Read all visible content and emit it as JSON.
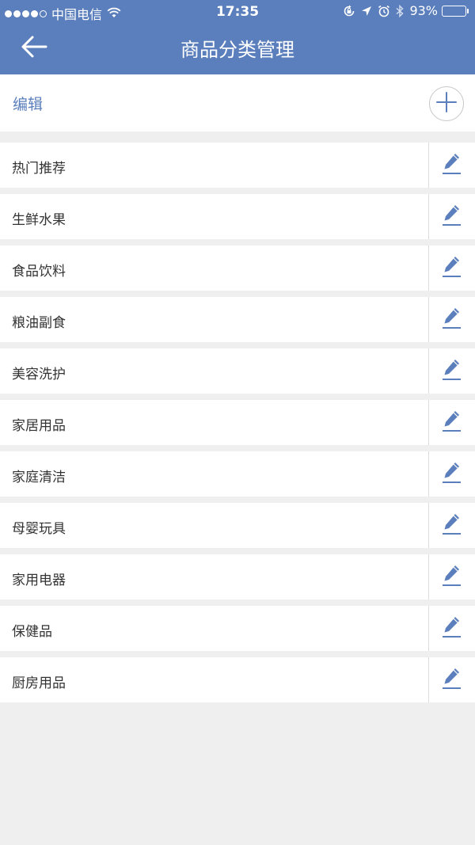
{
  "status_bar": {
    "carrier": "中国电信",
    "time": "17:35",
    "battery": "93%",
    "battery_level": 0.93,
    "signal_dots_filled": 4,
    "signal_dots_total": 5
  },
  "header": {
    "title": "商品分类管理",
    "back_icon": "arrow-left-icon",
    "background": "#5b7fbc"
  },
  "toolbar": {
    "edit_label": "编辑",
    "add_icon": "plus-circle-icon",
    "accent": "#5b7fbc"
  },
  "categories": [
    {
      "label": "热门推荐"
    },
    {
      "label": "生鲜水果"
    },
    {
      "label": "食品饮料"
    },
    {
      "label": "粮油副食"
    },
    {
      "label": "美容洗护"
    },
    {
      "label": "家居用品"
    },
    {
      "label": "家庭清洁"
    },
    {
      "label": "母婴玩具"
    },
    {
      "label": "家用电器"
    },
    {
      "label": "保健品"
    },
    {
      "label": "厨房用品"
    }
  ]
}
